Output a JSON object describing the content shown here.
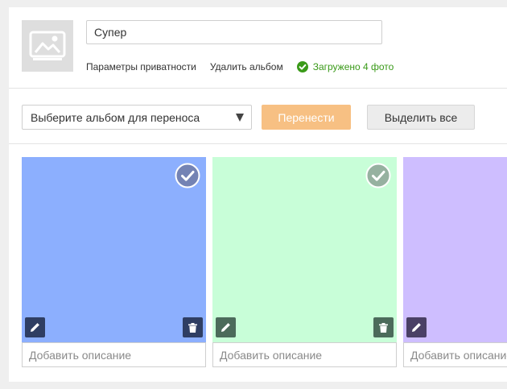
{
  "album": {
    "title_value": "Супер",
    "privacy_link": "Параметры приватности",
    "delete_link": "Удалить альбом",
    "upload_status": "Загружено 4 фото"
  },
  "toolbar": {
    "album_select_label": "Выберите альбом для переноса",
    "move_button": "Перенести",
    "select_all_button": "Выделить все"
  },
  "photos": [
    {
      "color": "#8caffe",
      "selected": true,
      "tool_color": "#2f3e63",
      "description_placeholder": "Добавить описание"
    },
    {
      "color": "#c8fed8",
      "selected": true,
      "tool_color": "#4c6b5b",
      "description_placeholder": "Добавить описание"
    },
    {
      "color": "#cebeff",
      "selected": false,
      "tool_color": "#4a4066",
      "description_placeholder": "Добавить описание"
    }
  ],
  "colors": {
    "accent_button": "#f7c083",
    "status_green": "#3a9a19"
  }
}
